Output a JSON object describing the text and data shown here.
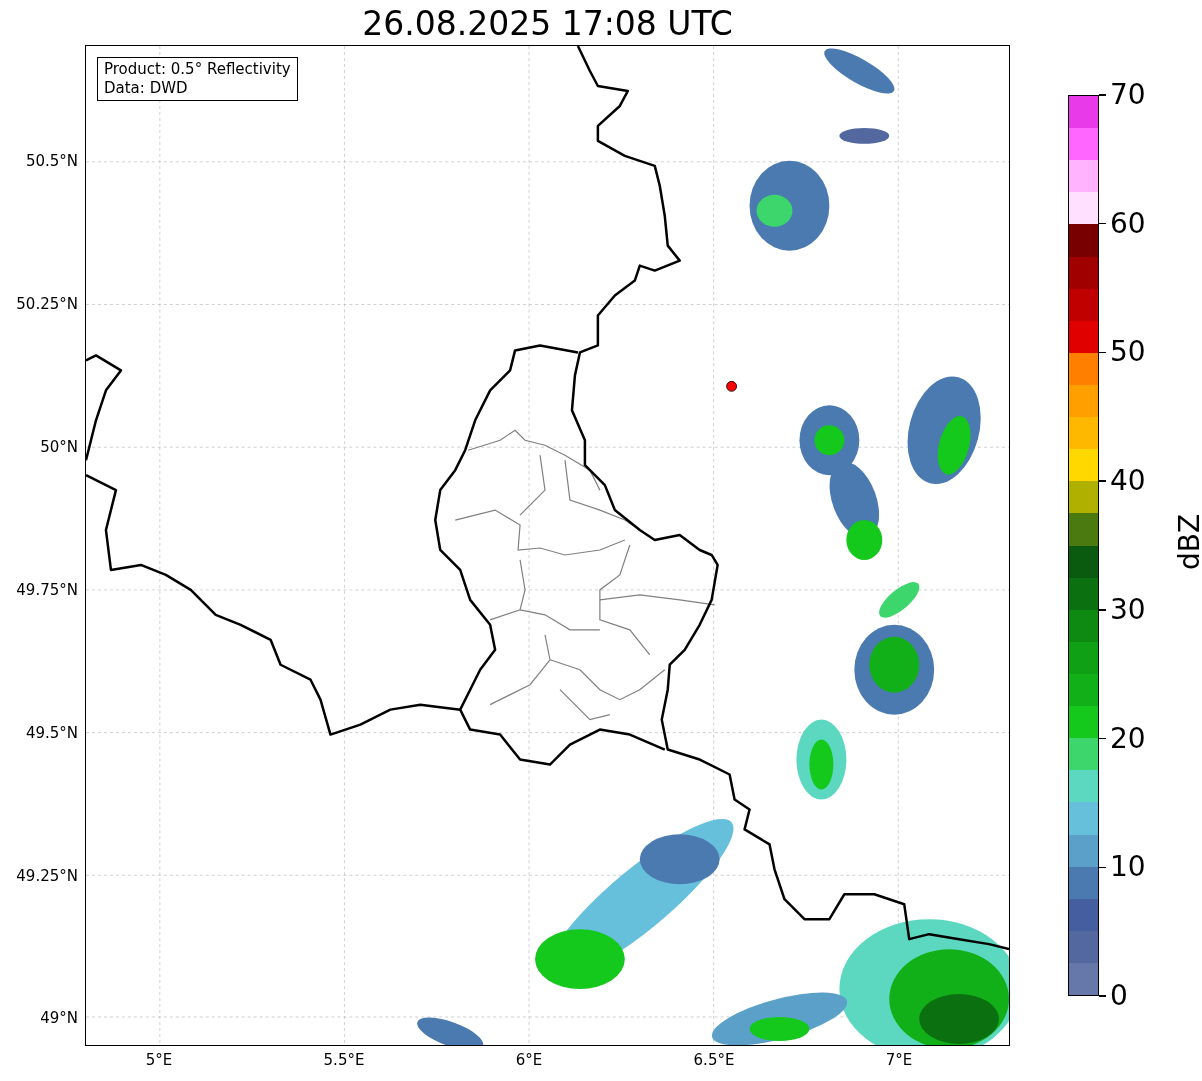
{
  "title": "26.08.2025 17:08 UTC",
  "legend": [
    "Product: 0.5° Reflectivity",
    "Data: DWD"
  ],
  "map": {
    "lat_labels": [
      "50.5°N",
      "50.25°N",
      "50°N",
      "49.75°N",
      "49.5°N",
      "49.25°N",
      "49°N"
    ],
    "lon_labels": [
      "5°E",
      "5.5°E",
      "6°E",
      "6.5°E",
      "7°E"
    ]
  },
  "colorbar": {
    "label": "dBZ",
    "ticks": [
      "70",
      "60",
      "50",
      "40",
      "30",
      "20",
      "10",
      "0"
    ],
    "segments": [
      {
        "color": "#e83ae8"
      },
      {
        "color": "#ff66ff"
      },
      {
        "color": "#ffb3ff"
      },
      {
        "color": "#ffe0ff"
      },
      {
        "color": "#780000"
      },
      {
        "color": "#a00000"
      },
      {
        "color": "#c00000"
      },
      {
        "color": "#e00000"
      },
      {
        "color": "#ff7f00"
      },
      {
        "color": "#ff9f00"
      },
      {
        "color": "#ffb800"
      },
      {
        "color": "#ffd800"
      },
      {
        "color": "#b0b000"
      },
      {
        "color": "#4a7a10"
      },
      {
        "color": "#0a5a10"
      },
      {
        "color": "#0b7010"
      },
      {
        "color": "#0e8a12"
      },
      {
        "color": "#10a015"
      },
      {
        "color": "#12b018"
      },
      {
        "color": "#14c81c"
      },
      {
        "color": "#3cd66c"
      },
      {
        "color": "#5cd8c0"
      },
      {
        "color": "#66c0dc"
      },
      {
        "color": "#5aa0c8"
      },
      {
        "color": "#4a7ab0"
      },
      {
        "color": "#445ea0"
      },
      {
        "color": "#52689e"
      },
      {
        "color": "#6677aa"
      }
    ]
  }
}
